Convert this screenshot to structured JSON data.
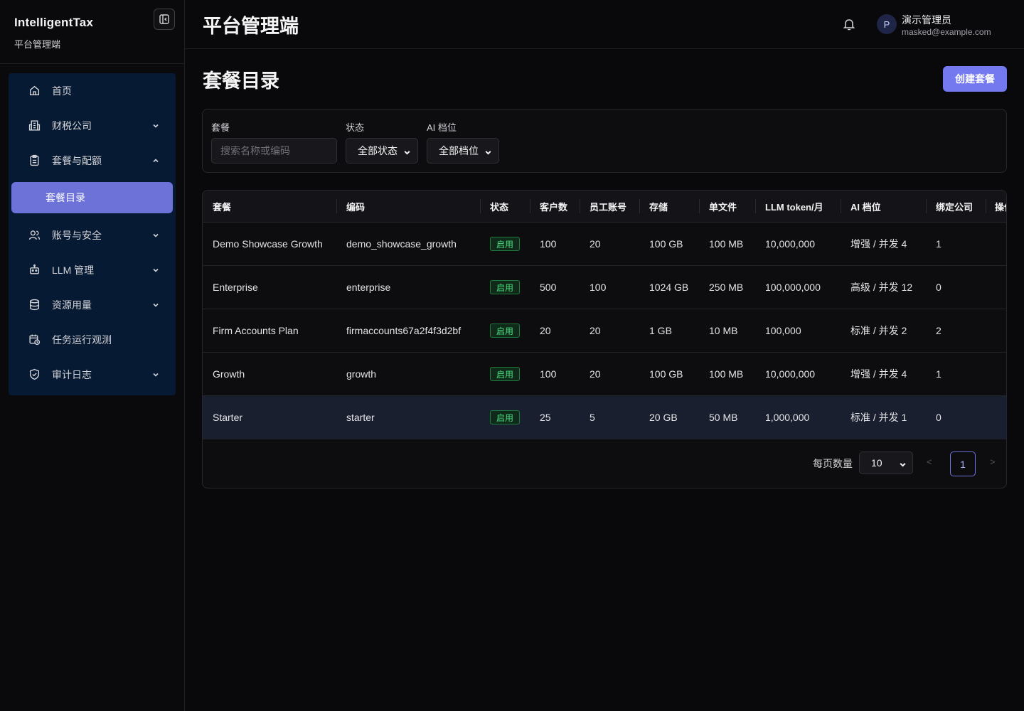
{
  "sidebar": {
    "brand": "IntelligentTax",
    "brand_sub": "平台管理端",
    "items": [
      {
        "label": "首页",
        "icon": "home-icon"
      },
      {
        "label": "财税公司",
        "icon": "building-icon"
      },
      {
        "label": "套餐与配额",
        "icon": "clipboard-icon"
      },
      {
        "label": "套餐目录"
      },
      {
        "label": "账号与安全",
        "icon": "users-icon"
      },
      {
        "label": "LLM 管理",
        "icon": "robot-icon"
      },
      {
        "label": "资源用量",
        "icon": "database-icon"
      },
      {
        "label": "任务运行观测",
        "icon": "calendar-clock-icon"
      },
      {
        "label": "审计日志",
        "icon": "shield-icon"
      }
    ]
  },
  "header": {
    "title": "平台管理端",
    "user_initial": "P",
    "user_name": "演示管理员",
    "user_email": "masked@example.com"
  },
  "page": {
    "title": "套餐目录",
    "create_label": "创建套餐"
  },
  "filters": {
    "plan_label": "套餐",
    "plan_placeholder": "搜索名称或编码",
    "status_label": "状态",
    "status_value": "全部状态",
    "tier_label": "AI 档位",
    "tier_value": "全部档位"
  },
  "table": {
    "columns": [
      "套餐",
      "编码",
      "状态",
      "客户数",
      "员工账号",
      "存储",
      "单文件",
      "LLM token/月",
      "AI 档位",
      "绑定公司",
      "操作"
    ],
    "rows": [
      {
        "name": "Demo Showcase Growth",
        "code": "demo_showcase_growth",
        "status": "启用",
        "clients": "100",
        "staff": "20",
        "storage": "100 GB",
        "file": "100 MB",
        "tokens": "10,000,000",
        "tier": "增强 / 并发 4",
        "bound": "1"
      },
      {
        "name": "Enterprise",
        "code": "enterprise",
        "status": "启用",
        "clients": "500",
        "staff": "100",
        "storage": "1024 GB",
        "file": "250 MB",
        "tokens": "100,000,000",
        "tier": "高级 / 并发 12",
        "bound": "0"
      },
      {
        "name": "Firm Accounts Plan",
        "code": "firmaccounts67a2f4f3d2bf",
        "status": "启用",
        "clients": "20",
        "staff": "20",
        "storage": "1 GB",
        "file": "10 MB",
        "tokens": "100,000",
        "tier": "标准 / 并发 2",
        "bound": "2"
      },
      {
        "name": "Growth",
        "code": "growth",
        "status": "启用",
        "clients": "100",
        "staff": "20",
        "storage": "100 GB",
        "file": "100 MB",
        "tokens": "10,000,000",
        "tier": "增强 / 并发 4",
        "bound": "1"
      },
      {
        "name": "Starter",
        "code": "starter",
        "status": "启用",
        "clients": "25",
        "staff": "5",
        "storage": "20 GB",
        "file": "50 MB",
        "tokens": "1,000,000",
        "tier": "标准 / 并发 1",
        "bound": "0"
      }
    ]
  },
  "pagination": {
    "per_page_label": "每页数量",
    "per_page_value": "10",
    "prev": "<",
    "current_page": "1",
    "next": ">"
  },
  "colors": {
    "accent": "#6d72d9",
    "button": "#7579f0",
    "nav_bg": "#061a33",
    "status_green": "#4ade80"
  }
}
